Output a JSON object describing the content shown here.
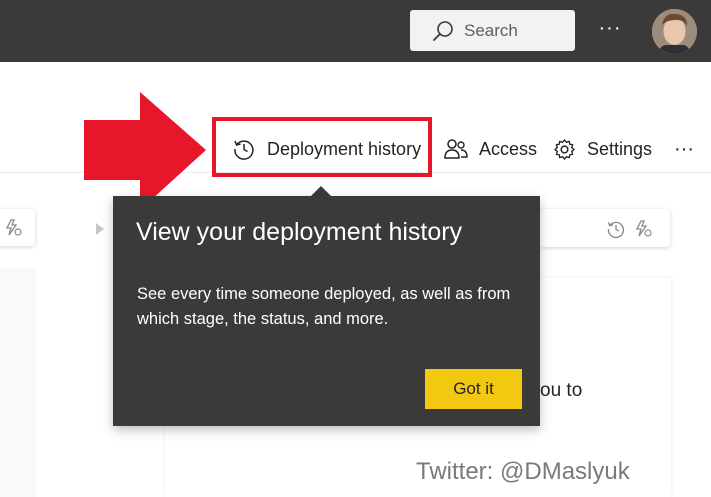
{
  "topbar": {
    "search_placeholder": "Search",
    "more_label": "···"
  },
  "toolbar": {
    "deployment_history": "Deployment history",
    "access": "Access",
    "settings": "Settings",
    "more_label": "···"
  },
  "background": {
    "partial_text": "ou to"
  },
  "callout": {
    "title": "View your deployment history",
    "body": "See every time someone deployed, as well as from which stage, the status, and more.",
    "button": "Got it"
  },
  "watermark": "Twitter: @DMaslyuk",
  "colors": {
    "topbar": "#3b3a39",
    "highlight": "#e8162a",
    "accent_button": "#f2c811",
    "callout_bg": "#3b3a39"
  }
}
